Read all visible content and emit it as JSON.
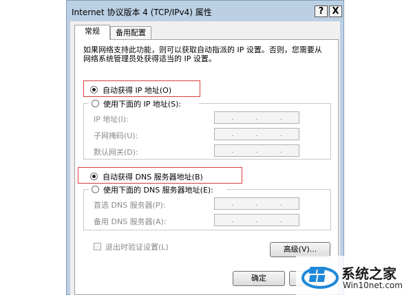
{
  "window": {
    "title": "Internet 协议版本 4 (TCP/IPv4) 属性",
    "help_label": "?",
    "close_label": "X"
  },
  "tabs": [
    {
      "label": "常规"
    },
    {
      "label": "备用配置"
    }
  ],
  "description": "如果网络支持此功能，则可以获取自动指派的 IP 设置。否则，您需要从网络系统管理员处获得适当的 IP 设置。",
  "ip": {
    "auto_label": "自动获得 IP 地址(O)",
    "manual_label": "使用下面的 IP 地址(S):",
    "auto_selected": true,
    "fields": [
      {
        "label": "IP 地址(I):"
      },
      {
        "label": "子网掩码(U):"
      },
      {
        "label": "默认网关(D):"
      }
    ]
  },
  "dns": {
    "auto_label": "自动获得 DNS 服务器地址(B)",
    "manual_label": "使用下面的 DNS 服务器地址(E):",
    "auto_selected": true,
    "fields": [
      {
        "label": "首选 DNS 服务器(P):"
      },
      {
        "label": "备用 DNS 服务器(A):"
      }
    ]
  },
  "validate_label": "退出时验证设置(L)",
  "advanced_label": "高级(V)...",
  "ok_label": "确定",
  "ip_dot": ".",
  "watermark": {
    "title": "系统之家",
    "url": "Win10net.com"
  },
  "colors": {
    "highlight": "#d93b3b",
    "window_frame": "#bcd0e4"
  }
}
